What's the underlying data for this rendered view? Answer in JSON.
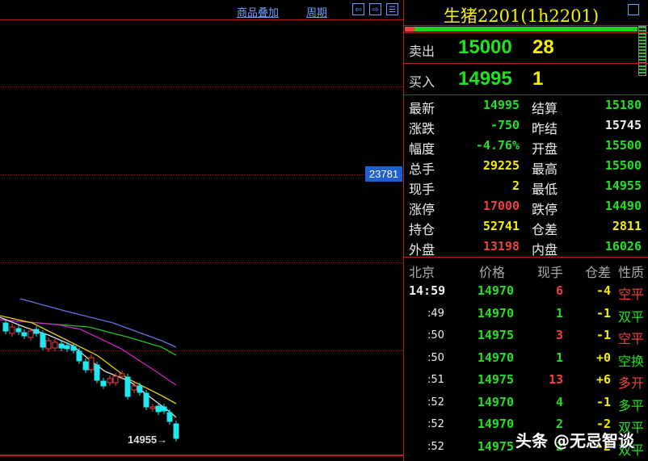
{
  "chart": {
    "overlay_link": "商品叠加",
    "period_link": "周期",
    "price_label": "23781",
    "last_price_marker": "14955"
  },
  "colors": {
    "up": "#f04040",
    "down": "#20e8f0",
    "ma1": "#e0e0e0",
    "ma2": "#e0d020",
    "ma3": "#d020d0",
    "ma4": "#20c020",
    "ma5": "#6a70e0"
  },
  "panel": {
    "title": "生猪2201(1h2201)",
    "bid_ask_ratio": 0.04,
    "sell": {
      "label": "卖出",
      "price": "15000",
      "volume": "28"
    },
    "buy": {
      "label": "买入",
      "price": "14995",
      "volume": "1"
    },
    "stats": [
      {
        "l1": "最新",
        "v1": "14995",
        "c1": "g",
        "l2": "结算",
        "v2": "15180",
        "c2": "g"
      },
      {
        "l1": "涨跌",
        "v1": "-750",
        "c1": "g",
        "l2": "昨结",
        "v2": "15745",
        "c2": "w"
      },
      {
        "l1": "幅度",
        "v1": "-4.76%",
        "c1": "g",
        "l2": "开盘",
        "v2": "15500",
        "c2": "g"
      },
      {
        "l1": "总手",
        "v1": "29225",
        "c1": "y",
        "l2": "最高",
        "v2": "15500",
        "c2": "g"
      },
      {
        "l1": "现手",
        "v1": "2",
        "c1": "y",
        "l2": "最低",
        "v2": "14955",
        "c2": "g"
      },
      {
        "l1": "涨停",
        "v1": "17000",
        "c1": "r",
        "l2": "跌停",
        "v2": "14490",
        "c2": "g"
      },
      {
        "l1": "持仓",
        "v1": "52741",
        "c1": "y",
        "l2": "仓差",
        "v2": "2811",
        "c2": "y"
      },
      {
        "l1": "外盘",
        "v1": "13198",
        "c1": "r",
        "l2": "内盘",
        "v2": "16026",
        "c2": "g"
      }
    ],
    "ticks_header": [
      "北京",
      "价格",
      "现手",
      "仓差",
      "性质"
    ],
    "ticks": [
      {
        "time": "14:59",
        "price": "14970",
        "vol": "6",
        "vc": "r",
        "oi": "-4",
        "nature": "空平",
        "nc": "r"
      },
      {
        "time": ":49",
        "price": "14970",
        "vol": "1",
        "vc": "g",
        "oi": "-1",
        "nature": "双平",
        "nc": "g"
      },
      {
        "time": ":50",
        "price": "14975",
        "vol": "3",
        "vc": "r",
        "oi": "-1",
        "nature": "空平",
        "nc": "r"
      },
      {
        "time": ":50",
        "price": "14970",
        "vol": "1",
        "vc": "g",
        "oi": "+0",
        "nature": "空换",
        "nc": "g"
      },
      {
        "time": ":51",
        "price": "14975",
        "vol": "13",
        "vc": "r",
        "oi": "+6",
        "nature": "多开",
        "nc": "r"
      },
      {
        "time": ":52",
        "price": "14970",
        "vol": "4",
        "vc": "g",
        "oi": "-1",
        "nature": "多平",
        "nc": "g"
      },
      {
        "time": ":52",
        "price": "14970",
        "vol": "2",
        "vc": "g",
        "oi": "-2",
        "nature": "双平",
        "nc": "g"
      },
      {
        "time": ":52",
        "price": "14975",
        "vol": "2",
        "vc": "g",
        "oi": "-2",
        "nature": "双平",
        "nc": "g"
      }
    ]
  },
  "watermark": "头条 @无忌智谈"
}
